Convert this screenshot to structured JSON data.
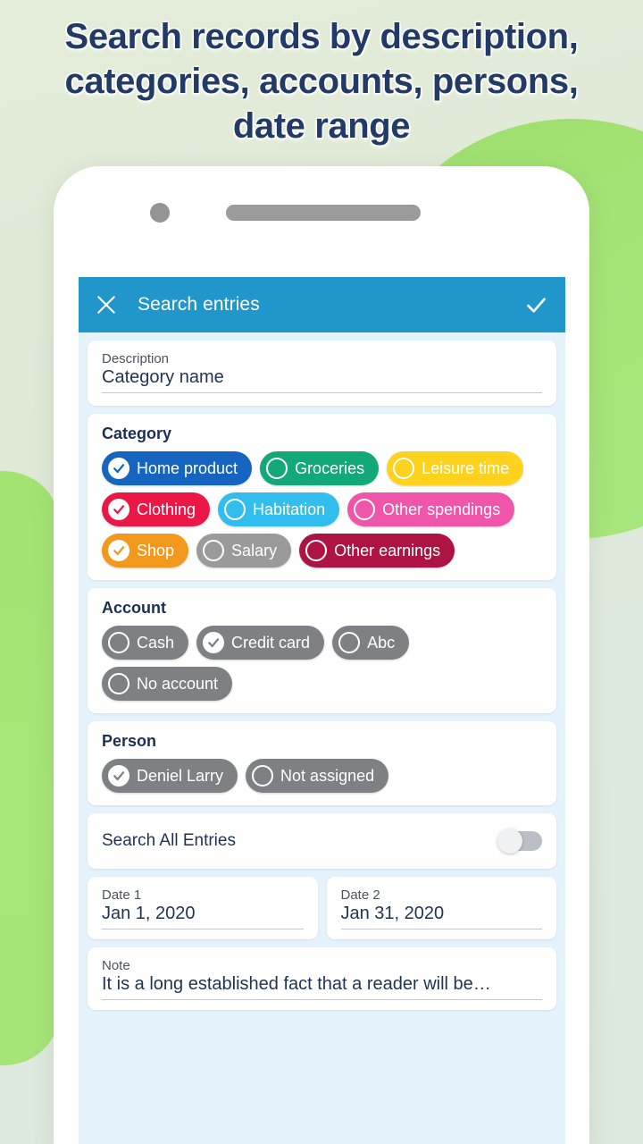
{
  "headline": "Search records by description, categories, accounts, persons, date range",
  "colors": {
    "appbar": "#2196ca",
    "screen_bg": "#e4f2fb",
    "headline_text": "#223b66",
    "accent_green": "#a5e477"
  },
  "phone": {
    "camera_icon": "camera-dot",
    "speaker_icon": "speaker-bar"
  },
  "appbar": {
    "title": "Search entries",
    "close_icon": "close-icon",
    "confirm_icon": "check-icon"
  },
  "description": {
    "label": "Description",
    "value": "Category name",
    "placeholder": "Description"
  },
  "category": {
    "title": "Category",
    "chips": [
      {
        "label": "Home product",
        "color": "#1565c0",
        "checked": true
      },
      {
        "label": "Groceries",
        "color": "#12a877",
        "checked": false
      },
      {
        "label": "Leisure time",
        "color": "#ffd21e",
        "checked": false
      },
      {
        "label": "Clothing",
        "color": "#eb1847",
        "checked": true
      },
      {
        "label": "Habitation",
        "color": "#32bdef",
        "checked": false
      },
      {
        "label": "Other spendings",
        "color": "#ef55a8",
        "checked": false
      },
      {
        "label": "Shop",
        "color": "#f2991d",
        "checked": true
      },
      {
        "label": "Salary",
        "color": "#9a9a9a",
        "checked": false
      },
      {
        "label": "Other earnings",
        "color": "#ad1343",
        "checked": false
      }
    ]
  },
  "account": {
    "title": "Account",
    "chips": [
      {
        "label": "Cash",
        "color": "#7e8084",
        "checked": false
      },
      {
        "label": "Credit card",
        "color": "#7e8084",
        "checked": true
      },
      {
        "label": "Abc",
        "color": "#7e8084",
        "checked": false
      },
      {
        "label": "No account",
        "color": "#7e8084",
        "checked": false
      }
    ]
  },
  "person": {
    "title": "Person",
    "chips": [
      {
        "label": "Deniel Larry",
        "color": "#7e8084",
        "checked": true
      },
      {
        "label": "Not assigned",
        "color": "#7e8084",
        "checked": false
      }
    ]
  },
  "search_all": {
    "label": "Search All Entries",
    "enabled": false
  },
  "date_1": {
    "label": "Date 1",
    "value": "Jan 1, 2020"
  },
  "date_2": {
    "label": "Date 2",
    "value": "Jan 31, 2020"
  },
  "note": {
    "label": "Note",
    "value": "It is a long established fact that a reader will be…"
  }
}
